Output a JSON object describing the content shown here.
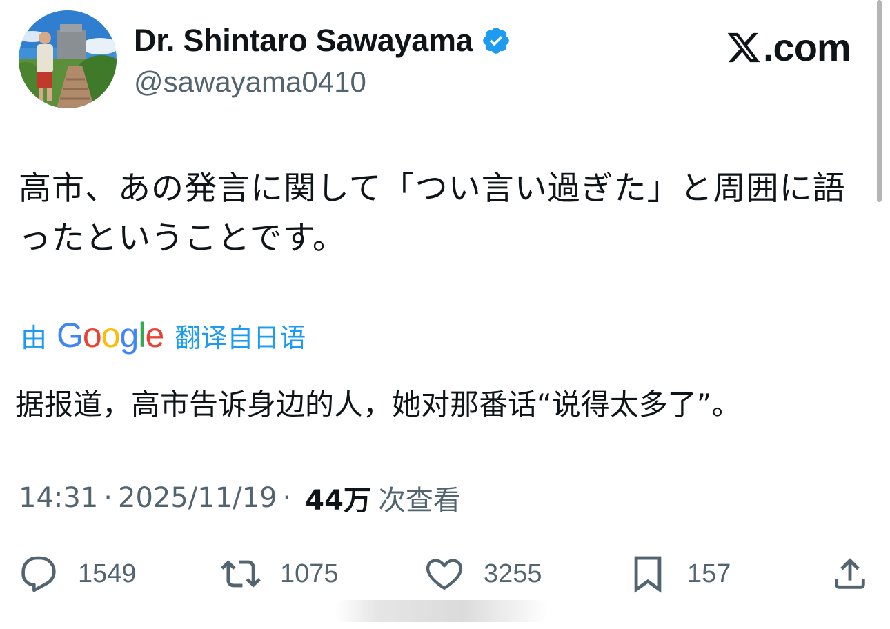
{
  "author": {
    "name": "Dr. Shintaro Sawayama",
    "handle": "@sawayama0410",
    "verified": true
  },
  "brand": {
    "logo_text": ".com",
    "icon": "x-logo-icon"
  },
  "tweet": {
    "text": "高市、あの発言に関して「つい言い過ぎた」と周囲に語ったということです。"
  },
  "translation": {
    "prefix": "由",
    "provider": "Google",
    "suffix": "翻译自日语",
    "text": "据报道，高市告诉身边的人，她对那番话“说得太多了”。"
  },
  "meta": {
    "time": "14:31",
    "separator": "·",
    "date": "2025/11/19",
    "views": "44万",
    "views_label": "次查看"
  },
  "actions": {
    "replies": "1549",
    "reposts": "1075",
    "likes": "3255",
    "bookmarks": "157"
  },
  "colors": {
    "accent": "#1d9bf0",
    "text": "#0f1419",
    "secondary": "#536471"
  }
}
